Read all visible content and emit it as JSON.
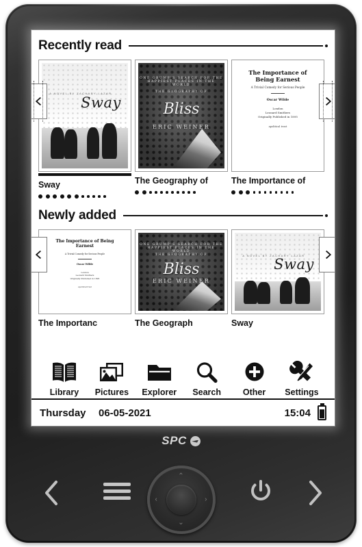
{
  "device": {
    "brand": "SPC",
    "brand_icon": "spc-check-mark-icon",
    "hardware": {
      "prev_icon": "chevron-left-icon",
      "menu_icon": "hamburger-menu-icon",
      "dpad_icon": "dpad-navigation-icon",
      "dpad_up": "⌃",
      "dpad_down": "⌄",
      "dpad_left": "‹",
      "dpad_right": "›",
      "power_icon": "power-icon",
      "next_icon": "chevron-right-icon"
    }
  },
  "screen": {
    "sections": [
      {
        "id": "recently-read",
        "title": "Recently read",
        "prev_icon": "chevron-left-icon",
        "next_icon": "chevron-right-icon",
        "books": [
          {
            "title": "Sway",
            "cover": "sway",
            "selected": true,
            "progress_filled": 6,
            "progress_total": 11,
            "cover_text": {
              "title": "Sway",
              "byline": "A NOVEL BY ZACHARY LAZAR"
            }
          },
          {
            "title": "The Geography of",
            "cover": "bliss",
            "selected": false,
            "progress_filled": 2,
            "progress_total": 11,
            "cover_text": {
              "kicker": "ONE GRUMP'S SEARCH FOR THE HAPPIEST PLACES IN THE WORLD",
              "line1": "THE GEOGRAPHY OF",
              "title": "Bliss",
              "author": "ERIC WEINER"
            }
          },
          {
            "title": "The Importance of",
            "cover": "earnest",
            "selected": false,
            "progress_filled": 3,
            "progress_total": 11,
            "cover_text": {
              "title": "The Importance of Being Earnest",
              "subtitle": "A Trivial Comedy for Serious People",
              "author": "Oscar Wilde",
              "imprint": "London\nLeonard Smithers\nOriginally Published in 1895",
              "footer": "apolitical trust"
            }
          }
        ]
      },
      {
        "id": "newly-added",
        "title": "Newly added",
        "prev_icon": "chevron-left-icon",
        "next_icon": "chevron-right-icon",
        "books": [
          {
            "title": "The Importanc",
            "cover": "earnest",
            "cover_text": {
              "title": "The Importance of Being Earnest",
              "subtitle": "A Trivial Comedy for Serious People",
              "author": "Oscar Wilde",
              "imprint": "London\nLeonard Smithers\nOriginally Published in 1895",
              "footer": "apolitical trust"
            }
          },
          {
            "title": "The Geograph",
            "cover": "bliss",
            "cover_text": {
              "kicker": "ONE GRUMP'S SEARCH FOR THE HAPPIEST PLACES IN THE WORLD",
              "line1": "THE GEOGRAPHY OF",
              "title": "Bliss",
              "author": "ERIC WEINER"
            }
          },
          {
            "title": "Sway",
            "cover": "sway",
            "cover_text": {
              "title": "Sway",
              "byline": "A NOVEL BY ZACHARY LAZAR"
            }
          }
        ]
      }
    ],
    "toolbar": [
      {
        "label": "Library",
        "icon": "open-book-icon"
      },
      {
        "label": "Pictures",
        "icon": "photos-icon"
      },
      {
        "label": "Explorer",
        "icon": "folder-icon"
      },
      {
        "label": "Search",
        "icon": "magnifier-icon"
      },
      {
        "label": "Other",
        "icon": "plus-circle-icon"
      },
      {
        "label": "Settings",
        "icon": "wrench-screwdriver-icon"
      }
    ],
    "statusbar": {
      "day": "Thursday",
      "date": "06-05-2021",
      "time": "15:04",
      "battery_icon": "battery-icon",
      "battery_level": "high"
    }
  },
  "colors": {
    "ink": "#111111",
    "paper": "#ffffff",
    "frame": "#9a9a9a",
    "bezel": "#262626"
  }
}
